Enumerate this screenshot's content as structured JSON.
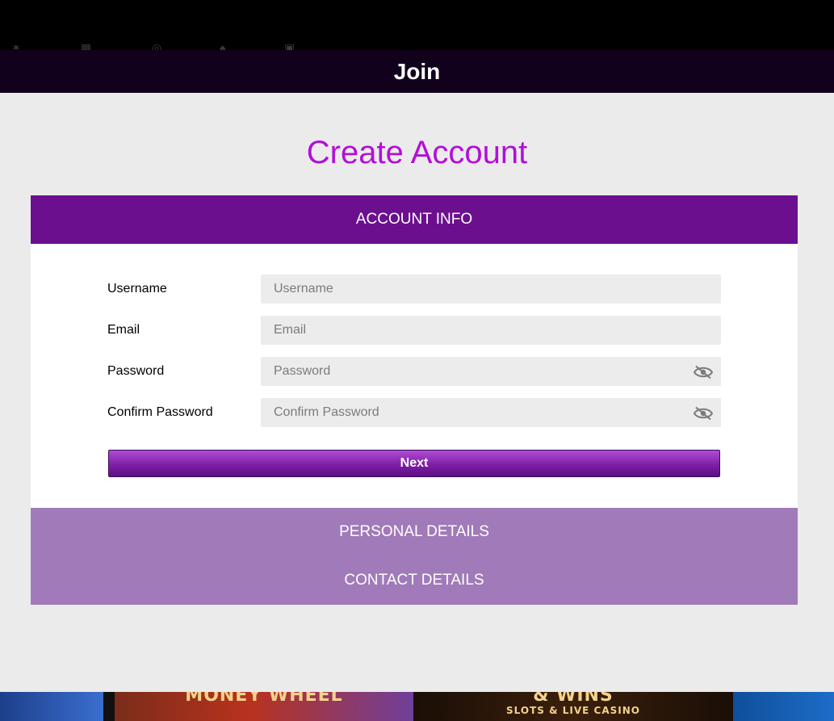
{
  "modal": {
    "title": "Join"
  },
  "heading": "Create Account",
  "sections": {
    "active": "ACCOUNT INFO",
    "collapsed": [
      "PERSONAL DETAILS",
      "CONTACT DETAILS"
    ]
  },
  "form": {
    "username": {
      "label": "Username",
      "placeholder": "Username"
    },
    "email": {
      "label": "Email",
      "placeholder": "Email"
    },
    "password": {
      "label": "Password",
      "placeholder": "Password",
      "toggle_icon": "eye-slash-icon"
    },
    "confirm_password": {
      "label": "Confirm Password",
      "placeholder": "Confirm Password",
      "toggle_icon": "eye-slash-icon"
    },
    "next_label": "Next"
  },
  "background": {
    "promo_tiles": [
      {
        "big": "",
        "small": ""
      },
      {
        "big": "MONEY WHEEL",
        "small": ""
      },
      {
        "big": "& WINS",
        "small": "SLOTS & LIVE CASINO"
      },
      {
        "big": "",
        "small": ""
      }
    ]
  },
  "colors": {
    "heading": "#b20fd8",
    "active_section": "#6b0f8f",
    "collapsed_sections": "#a17ab9",
    "header_bar": "#11011d"
  }
}
